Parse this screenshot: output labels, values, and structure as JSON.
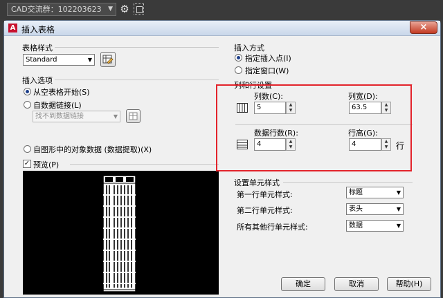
{
  "toolbar": {
    "search_text": "CAD交流群：102203623",
    "gear_icon": "gear-icon"
  },
  "window": {
    "title": "插入表格",
    "close": "×"
  },
  "table_style": {
    "label": "表格样式",
    "value": "Standard"
  },
  "insert_options": {
    "label": "插入选项",
    "opt1": "从空表格开始(S)",
    "opt2": "自数据链接(L)",
    "link_placeholder": "找不到数据链接",
    "opt3": "自图形中的对象数据 (数据提取)(X)"
  },
  "preview": {
    "label": "预览(P)",
    "checked": true
  },
  "insert_mode": {
    "label": "插入方式",
    "opt1": "指定插入点(I)",
    "opt2": "指定窗口(W)"
  },
  "rowcol": {
    "label": "列和行设置",
    "cols_label": "列数(C):",
    "cols": "5",
    "colwidth_label": "列宽(D):",
    "colwidth": "63.5",
    "rows_label": "数据行数(R):",
    "rows": "4",
    "rowheight_label": "行高(G):",
    "rowheight": "4",
    "unit": "行"
  },
  "cell_styles": {
    "label": "设置单元样式",
    "row1_label": "第一行单元样式:",
    "row1_value": "标题",
    "row2_label": "第二行单元样式:",
    "row2_value": "表头",
    "rest_label": "所有其他行单元样式:",
    "rest_value": "数据"
  },
  "buttons": {
    "ok": "确定",
    "cancel": "取消",
    "help": "帮助(H)"
  },
  "colors": {
    "highlight": "#e3232b",
    "dialog_bg": "#f0f0f0"
  }
}
